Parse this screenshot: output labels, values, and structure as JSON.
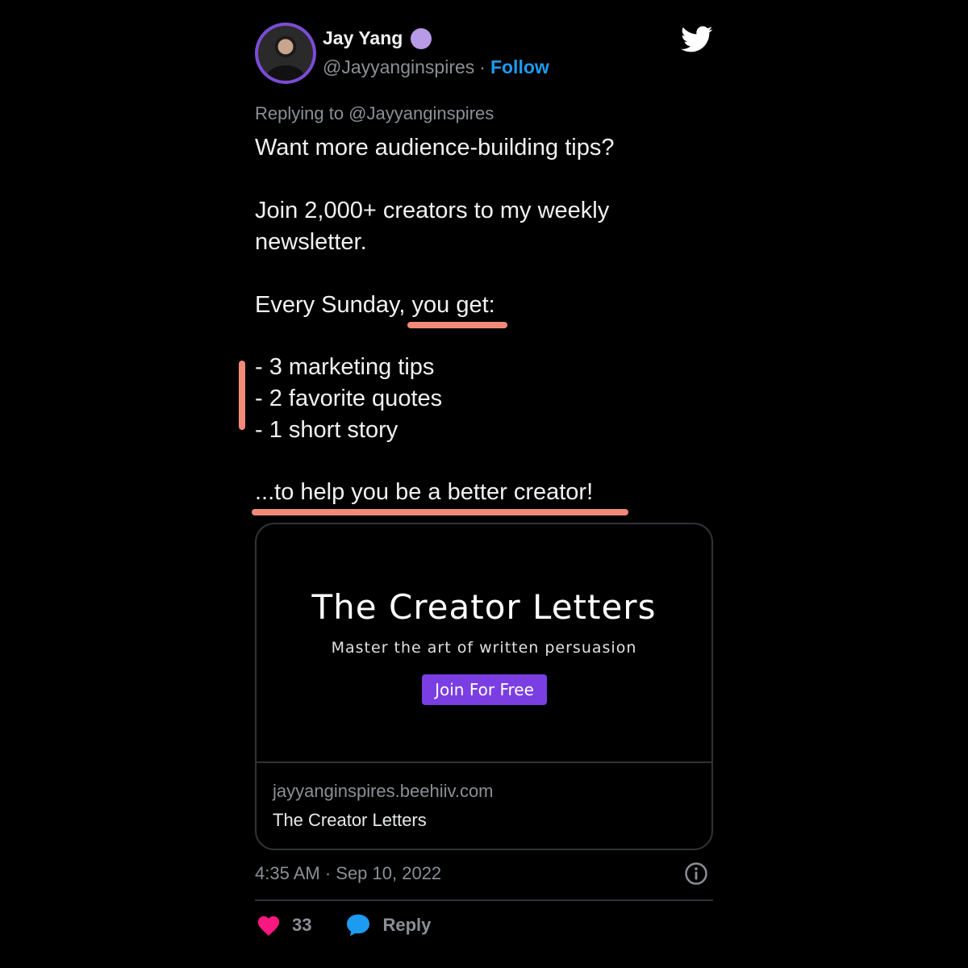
{
  "author": {
    "name": "Jay Yang",
    "handle": "@Jayyanginspires",
    "separator": "·",
    "follow_label": "Follow"
  },
  "tweet": {
    "replying_to": "Replying to @Jayyanginspires",
    "line1": "Want more audience-building tips?",
    "line2": "Join 2,000+ creators to my weekly",
    "line3": "newsletter.",
    "line4": "Every Sunday, you get:",
    "list": [
      "- 3 marketing tips",
      "- 2 favorite quotes",
      "- 1 short story"
    ],
    "closing": "...to help you be a better creator!"
  },
  "card": {
    "title": "The Creator Letters",
    "subtitle": "Master the art of written persuasion",
    "cta": "Join For Free",
    "domain": "jayyanginspires.beehiiv.com",
    "name": "The Creator Letters"
  },
  "meta": {
    "timestamp": "4:35 AM · Sep 10, 2022"
  },
  "actions": {
    "likes": "33",
    "reply_label": "Reply"
  },
  "colors": {
    "background": "#000000",
    "accent": "#1d9bf0",
    "highlight": "#f28a78",
    "like": "#f91880",
    "cta": "#7a3ee3",
    "badge": "#b89be6"
  },
  "icons": [
    "twitter-bird-icon",
    "verified-badge-icon",
    "info-icon",
    "heart-icon",
    "reply-bubble-icon"
  ]
}
